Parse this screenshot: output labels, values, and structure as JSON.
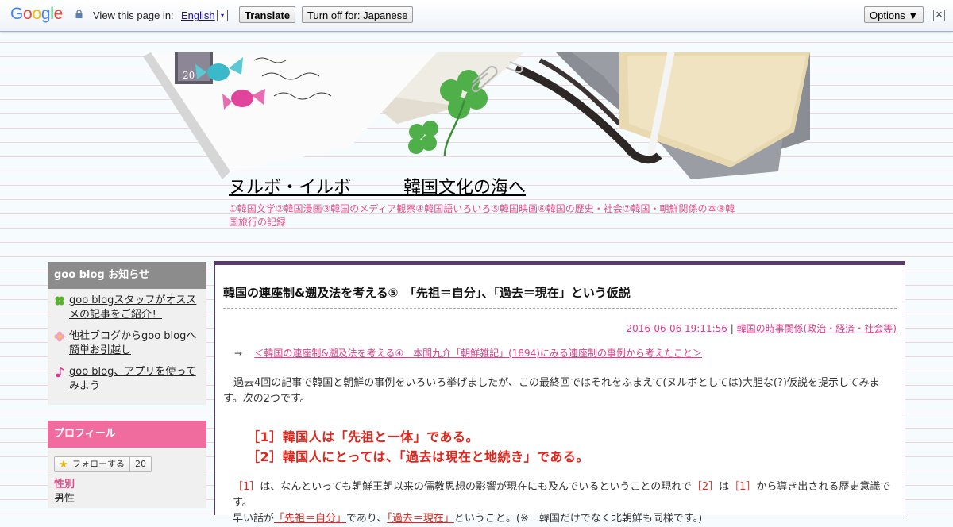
{
  "translate_bar": {
    "logo_letters": [
      "G",
      "o",
      "o",
      "g",
      "l",
      "e"
    ],
    "logo_colors": [
      "#4285f4",
      "#ea4335",
      "#fbbc05",
      "#4285f4",
      "#34a853",
      "#ea4335"
    ],
    "prompt": "View this page in:",
    "language": "English",
    "dropdown_glyph": "▾",
    "translate_label": "Translate",
    "turn_off_label": "Turn off for: Japanese",
    "options_label": "Options ▼",
    "close_glyph": "✕"
  },
  "blog": {
    "title": "ヌルボ・イルボ　　　韓国文化の海へ",
    "description": "①韓国文学②韓国漫画③韓国のメディア観察④韓国語いろいろ⑤韓国映画⑥韓国の歴史・社会⑦韓国・朝鮮関係の本⑧韓国旅行の記録"
  },
  "sidebar": {
    "news": {
      "heading": "goo blog お知らせ",
      "items": [
        {
          "label": "goo blogスタッフがオススメの記事をご紹介！",
          "icon": "clover-icon"
        },
        {
          "label": "他社ブログからgoo blogへ簡単お引越し",
          "icon": "flower-icon"
        },
        {
          "label": "goo blog、アプリを使ってみよう",
          "icon": "music-note-icon"
        }
      ]
    },
    "profile": {
      "heading": "プロフィール",
      "follow_label": "フォローする",
      "follow_count": "20",
      "gender_label": "性別",
      "gender_value": "男性"
    }
  },
  "entry": {
    "title": "韓国の連座制&遡及法を考える⑤　「先祖＝自分」、「過去＝現在」という仮説",
    "date": "2016-06-06 19:11:56",
    "separator": "|",
    "category": "韓国の時事関係(政治・経済・社会等)",
    "prev_arrow": "→",
    "prev_link": "＜韓国の連座制&遡及法を考える④　本間九介「朝鮮雑記」(1894)にみる連座制の事例から考えたこと＞",
    "intro": "過去4回の記事で韓国と朝鮮の事例をいろいろ挙げましたが、この最終回ではそれをふまえて(ヌルボとしては)大胆な(?)仮説を提示してみます。次の2つです。",
    "hypothesis_1": "［1］韓国人は「先祖と一体」である。",
    "hypothesis_2": "［2］韓国人にとっては、「過去は現在と地続き」である。",
    "para_ref_1": "［1］",
    "para_text_1": "は、なんといっても朝鮮王朝以来の儒教思想の影響が現在にも及んでいるということの現れで",
    "para_ref_2": "［2］",
    "para_text_2": "は",
    "para_ref_3": "［1］",
    "para_text_3": "から導き出される歴史意識です。",
    "para_text_4": "早い話が",
    "para_em_1": "「先祖＝自分」",
    "para_text_5": "であり、",
    "para_em_2": "「過去＝現在」",
    "para_text_6": "ということ。(※　韓国だけでなく北朝鮮も同様です。)"
  }
}
